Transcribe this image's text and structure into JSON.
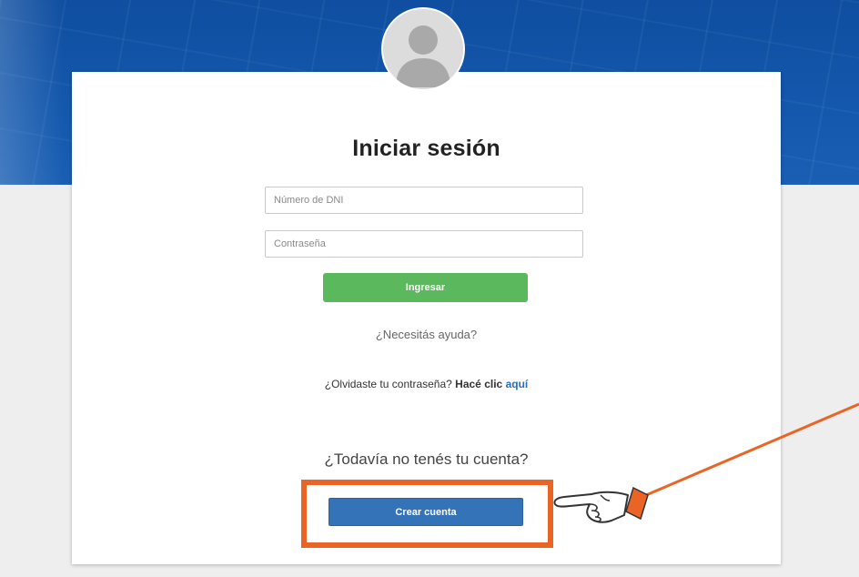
{
  "login": {
    "title": "Iniciar sesión",
    "dni_placeholder": "Número de DNI",
    "password_placeholder": "Contraseña",
    "submit_label": "Ingresar",
    "help_text": "¿Necesitás ayuda?",
    "forgot_prefix": "¿Olvidaste tu contraseña? ",
    "forgot_action": "Hacé clic",
    "forgot_link": "aquí",
    "no_account_text": "¿Todavía no tenés tu cuenta?",
    "create_account_label": "Crear cuenta"
  },
  "colors": {
    "header_blue": "#1458ad",
    "submit_green": "#5cb85c",
    "create_blue": "#3573b9",
    "highlight_orange": "#ea6525",
    "link_blue": "#2a6db5"
  },
  "icons": {
    "avatar": "user-silhouette-icon",
    "annotation": "pointing-hand-icon"
  }
}
